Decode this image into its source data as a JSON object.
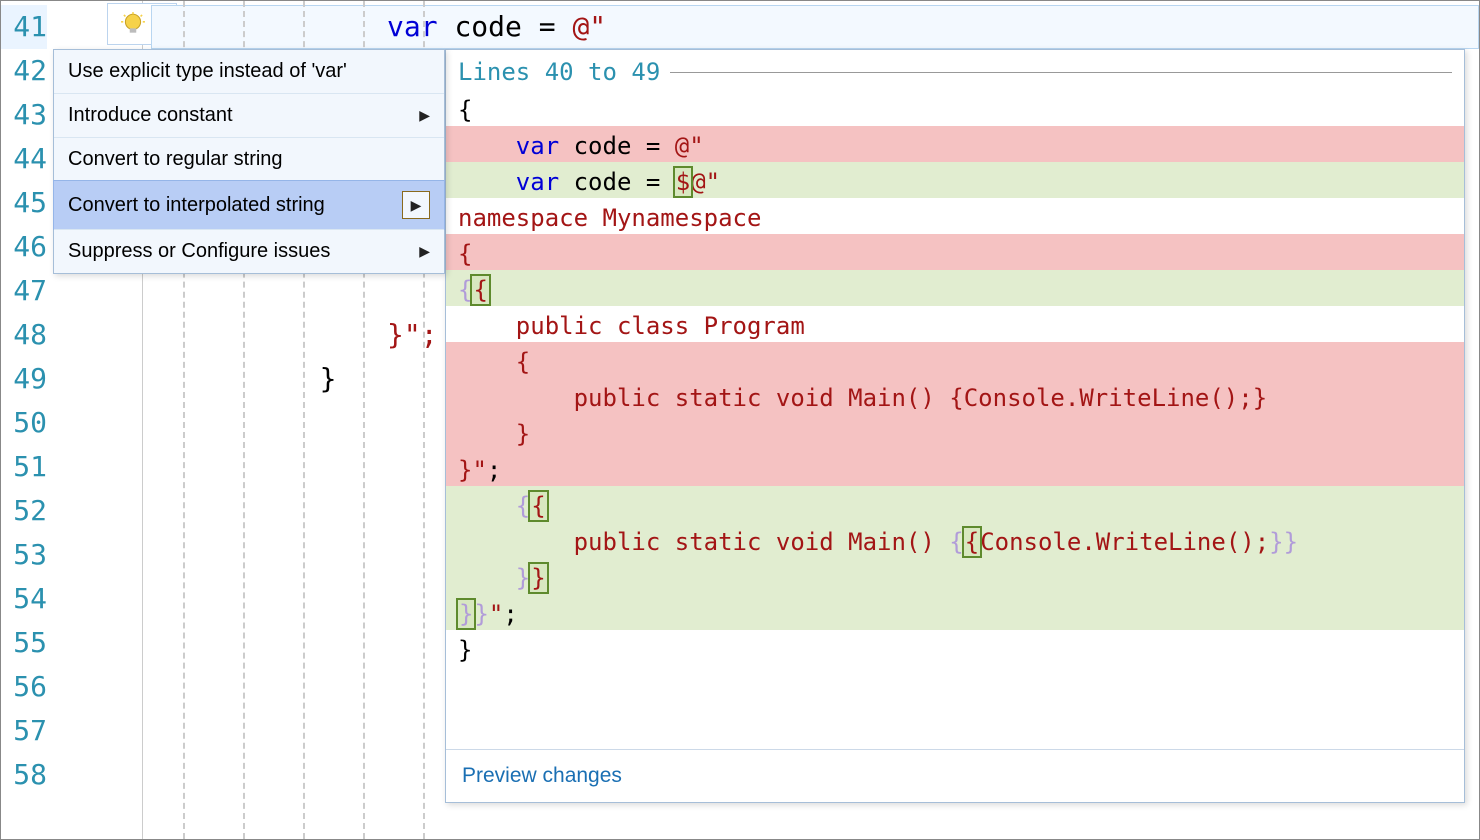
{
  "gutter": {
    "start": 41,
    "end": 58,
    "current": 41
  },
  "code": {
    "l41": {
      "var_kw": "var",
      "eq": " code = ",
      "str": "@\""
    },
    "l47_brace": "}",
    "l48": "}\";",
    "l49": "}"
  },
  "collapse_symbol": "−",
  "menu": {
    "items": [
      {
        "label": "Use explicit type instead of 'var'",
        "submenu": false
      },
      {
        "label": "Introduce constant",
        "submenu": true
      },
      {
        "label": "Convert to regular string",
        "submenu": false
      },
      {
        "label": "Convert to interpolated string",
        "submenu": true,
        "selected": true
      },
      {
        "label": "Suppress or Configure issues",
        "submenu": true
      }
    ]
  },
  "preview": {
    "header": "Lines 40 to 49",
    "footer": "Preview changes",
    "diff": [
      {
        "bg": "none",
        "plain": "{"
      },
      {
        "bg": "red",
        "segments": [
          {
            "t": "    "
          },
          {
            "t": "var",
            "c": "kw"
          },
          {
            "t": " code = "
          },
          {
            "t": "@\"",
            "c": "str"
          }
        ]
      },
      {
        "bg": "grn",
        "segments": [
          {
            "t": "    "
          },
          {
            "t": "var",
            "c": "kw"
          },
          {
            "t": " code = "
          },
          {
            "t": "$",
            "c": "str",
            "hl": true
          },
          {
            "t": "@\"",
            "c": "str"
          }
        ]
      },
      {
        "bg": "none",
        "segments": [
          {
            "t": "namespace Mynamespace",
            "c": "str"
          }
        ]
      },
      {
        "bg": "red",
        "segments": [
          {
            "t": "{",
            "c": "str"
          }
        ]
      },
      {
        "bg": "grn",
        "segments": [
          {
            "t": "{",
            "c": "fbrace"
          },
          {
            "t": "{",
            "c": "str",
            "hl": true
          }
        ]
      },
      {
        "bg": "none",
        "segments": [
          {
            "t": "    public class Program",
            "c": "str"
          }
        ]
      },
      {
        "bg": "red",
        "segments": [
          {
            "t": "    {",
            "c": "str"
          }
        ]
      },
      {
        "bg": "red",
        "segments": [
          {
            "t": "        public static void Main() {Console.WriteLine();}",
            "c": "str"
          }
        ]
      },
      {
        "bg": "red",
        "segments": [
          {
            "t": "    }",
            "c": "str"
          }
        ]
      },
      {
        "bg": "red",
        "segments": [
          {
            "t": "}\"",
            "c": "str"
          },
          {
            "t": ";"
          }
        ]
      },
      {
        "bg": "grn",
        "segments": [
          {
            "t": "    "
          },
          {
            "t": "{",
            "c": "fbrace"
          },
          {
            "t": "{",
            "c": "str",
            "hl": true
          }
        ]
      },
      {
        "bg": "grn",
        "segments": [
          {
            "t": "        public static void Main() ",
            "c": "str"
          },
          {
            "t": "{",
            "c": "fbrace"
          },
          {
            "t": "{",
            "c": "str",
            "hl": true
          },
          {
            "t": "Console.WriteLine();",
            "c": "str"
          },
          {
            "t": "}",
            "c": "fbrace"
          },
          {
            "t": "}",
            "c": "fbrace"
          }
        ]
      },
      {
        "bg": "grn",
        "segments": [
          {
            "t": "    "
          },
          {
            "t": "}",
            "c": "fbrace"
          },
          {
            "t": "}",
            "c": "str",
            "hl": true
          }
        ]
      },
      {
        "bg": "grn",
        "segments": [
          {
            "t": "}",
            "c": "fbrace",
            "hl": true
          },
          {
            "t": "}",
            "c": "fbrace"
          },
          {
            "t": "\"",
            "c": "str"
          },
          {
            "t": ";"
          }
        ]
      },
      {
        "bg": "none",
        "plain": "}"
      }
    ]
  }
}
